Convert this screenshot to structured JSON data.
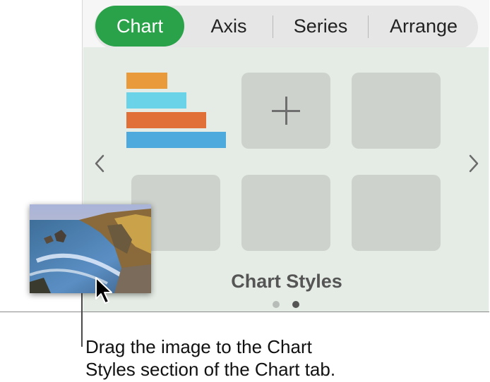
{
  "tabs": [
    {
      "label": "Chart",
      "active": true
    },
    {
      "label": "Axis",
      "active": false
    },
    {
      "label": "Series",
      "active": false
    },
    {
      "label": "Arrange",
      "active": false
    }
  ],
  "chart_styles": {
    "label": "Chart Styles",
    "page_count": 2,
    "current_page": 2,
    "preview_bar_colors": [
      "#e99a3a",
      "#6ad3e8",
      "#e06f38",
      "#4ea9dc"
    ],
    "add_style_icon": "plus-icon",
    "nav_prev_icon": "chevron-left-icon",
    "nav_next_icon": "chevron-right-icon"
  },
  "dragged_image": {
    "description_icon": "landscape-photo",
    "cursor_icon": "arrow-cursor-icon"
  },
  "caption": {
    "line1": "Drag the image to the Chart",
    "line2": "Styles section of the Chart tab."
  },
  "colors": {
    "accent": "#2aa249",
    "panel_bg": "#e5ece5",
    "tile_bg": "#cdd2cd"
  }
}
